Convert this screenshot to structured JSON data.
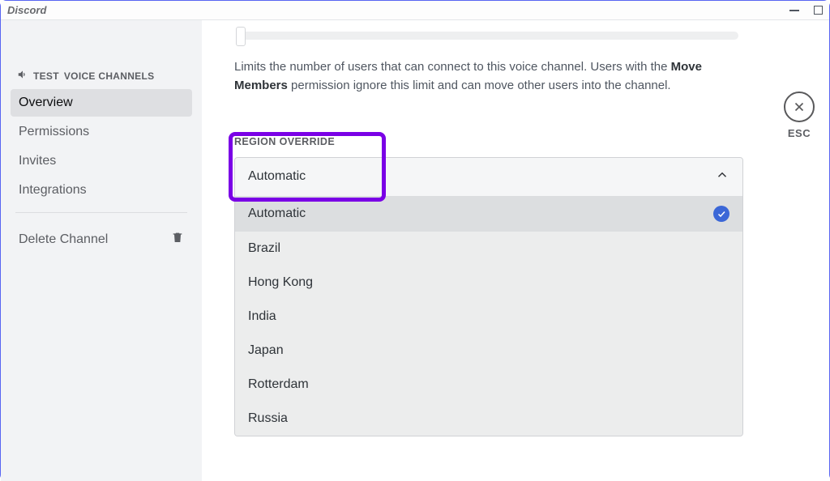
{
  "titlebar": {
    "title": "Discord"
  },
  "sidebar": {
    "header_prefix": "TEST",
    "header_label": "VOICE CHANNELS",
    "items": [
      {
        "label": "Overview",
        "active": true
      },
      {
        "label": "Permissions",
        "active": false
      },
      {
        "label": "Invites",
        "active": false
      },
      {
        "label": "Integrations",
        "active": false
      }
    ],
    "delete_label": "Delete Channel"
  },
  "content": {
    "help_pre": "Limits the number of users that can connect to this voice channel. Users with the ",
    "help_bold": "Move Members",
    "help_post": " permission ignore this limit and can move other users into the channel.",
    "region_label": "REGION OVERRIDE",
    "dropdown": {
      "selected": "Automatic",
      "options": [
        {
          "label": "Automatic",
          "selected": true
        },
        {
          "label": "Brazil",
          "selected": false
        },
        {
          "label": "Hong Kong",
          "selected": false
        },
        {
          "label": "India",
          "selected": false
        },
        {
          "label": "Japan",
          "selected": false
        },
        {
          "label": "Rotterdam",
          "selected": false
        },
        {
          "label": "Russia",
          "selected": false
        }
      ]
    }
  },
  "close": {
    "esc_label": "ESC"
  }
}
